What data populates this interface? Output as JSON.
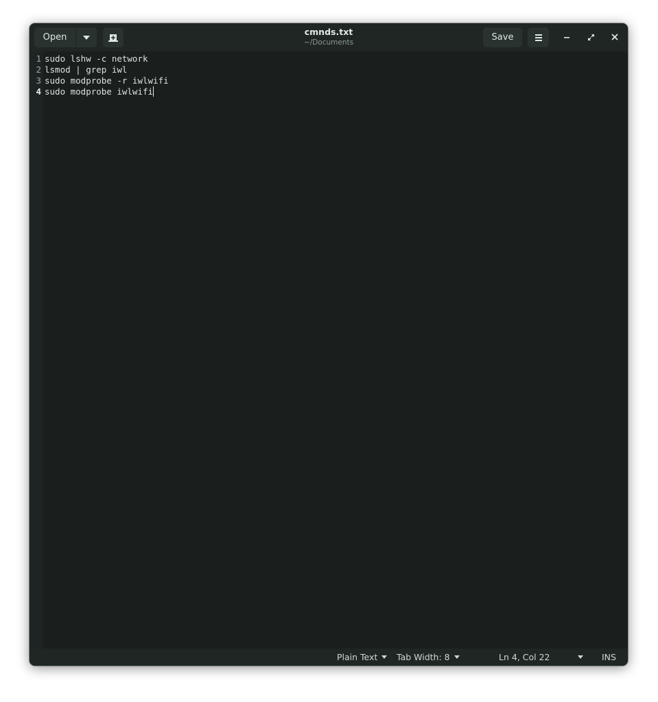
{
  "window": {
    "title": "cmnds.txt",
    "subtitle": "~/Documents"
  },
  "toolbar": {
    "open_label": "Open",
    "save_label": "Save"
  },
  "editor": {
    "lines": [
      "sudo lshw -c network",
      "lsmod | grep iwl",
      "sudo modprobe -r iwlwifi",
      "sudo modprobe iwlwifi"
    ],
    "line_numbers": [
      "1",
      "2",
      "3",
      "4"
    ],
    "current_line": 4
  },
  "statusbar": {
    "language": "Plain Text",
    "tab_width": "Tab Width: 8",
    "position": "Ln 4, Col 22",
    "mode": "INS"
  },
  "icons": {
    "open_menu": "chevron-down-icon",
    "new_tab": "new-tab-icon",
    "menu": "hamburger-icon",
    "minimize": "minimize-icon",
    "maximize": "maximize-icon",
    "close": "close-icon"
  },
  "colors": {
    "background": "#1a1f1e",
    "headerbar": "#1f2624",
    "button": "#29322f",
    "text": "#d9e2de"
  }
}
